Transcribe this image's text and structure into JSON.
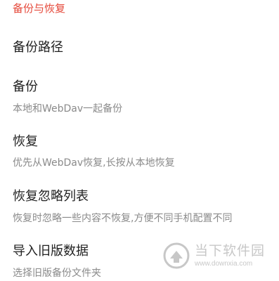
{
  "section": {
    "header": "备份与恢复"
  },
  "items": [
    {
      "title": "备份路径",
      "summary": ""
    },
    {
      "title": "备份",
      "summary": "本地和WebDav一起备份"
    },
    {
      "title": "恢复",
      "summary": "优先从WebDav恢复,长按从本地恢复"
    },
    {
      "title": "恢复忽略列表",
      "summary": "恢复时忽略一些内容不恢复,方便不同手机配置不同"
    },
    {
      "title": "导入旧版数据",
      "summary": "选择旧版备份文件夹"
    }
  ],
  "watermark": {
    "name": "当下软件园",
    "url": "www.downxia.com",
    "icon": "downxia-logo-icon"
  },
  "colors": {
    "accent": "#e5483a",
    "title": "#222222",
    "summary": "#8a8a8a",
    "background": "#ffffff"
  }
}
